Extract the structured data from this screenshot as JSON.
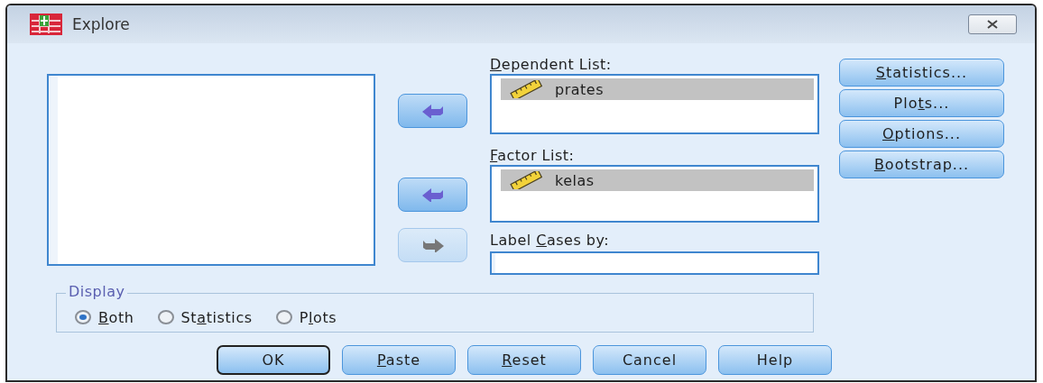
{
  "window": {
    "title": "Explore"
  },
  "move_buttons": [
    {
      "kind": "left",
      "disabled": false
    },
    {
      "kind": "left",
      "disabled": false
    },
    {
      "kind": "right",
      "disabled": true
    }
  ],
  "dependent_list": {
    "label": {
      "key": "D",
      "after": "ependent List:"
    },
    "items": [
      {
        "name": "prates",
        "selected": true
      }
    ]
  },
  "factor_list": {
    "label": {
      "key": "F",
      "after": "actor List:"
    },
    "items": [
      {
        "name": "kelas",
        "selected": true
      }
    ]
  },
  "label_cases": {
    "label": {
      "before": "Label ",
      "key": "C",
      "after": "ases by:"
    }
  },
  "side_buttons": [
    {
      "label": {
        "key": "S",
        "after": "tatistics..."
      }
    },
    {
      "label": {
        "before": "Plo",
        "key": "t",
        "after": "s..."
      }
    },
    {
      "label": {
        "key": "O",
        "after": "ptions..."
      }
    },
    {
      "label": {
        "key": "B",
        "after": "ootstrap..."
      }
    }
  ],
  "display": {
    "title": "Display",
    "options": [
      {
        "label": {
          "key": "B",
          "after": "oth"
        },
        "selected": true
      },
      {
        "label": {
          "before": "St",
          "key": "a",
          "after": "tistics"
        },
        "selected": false
      },
      {
        "label": {
          "before": "P",
          "key": "l",
          "after": "ots"
        },
        "selected": false
      }
    ]
  },
  "buttons": [
    {
      "label": "OK",
      "default": true
    },
    {
      "label": {
        "key": "P",
        "after": "aste"
      },
      "default": false
    },
    {
      "label": {
        "key": "R",
        "after": "eset"
      },
      "default": false
    },
    {
      "label": "Cancel",
      "default": false
    },
    {
      "label": "Help",
      "default": false
    }
  ]
}
